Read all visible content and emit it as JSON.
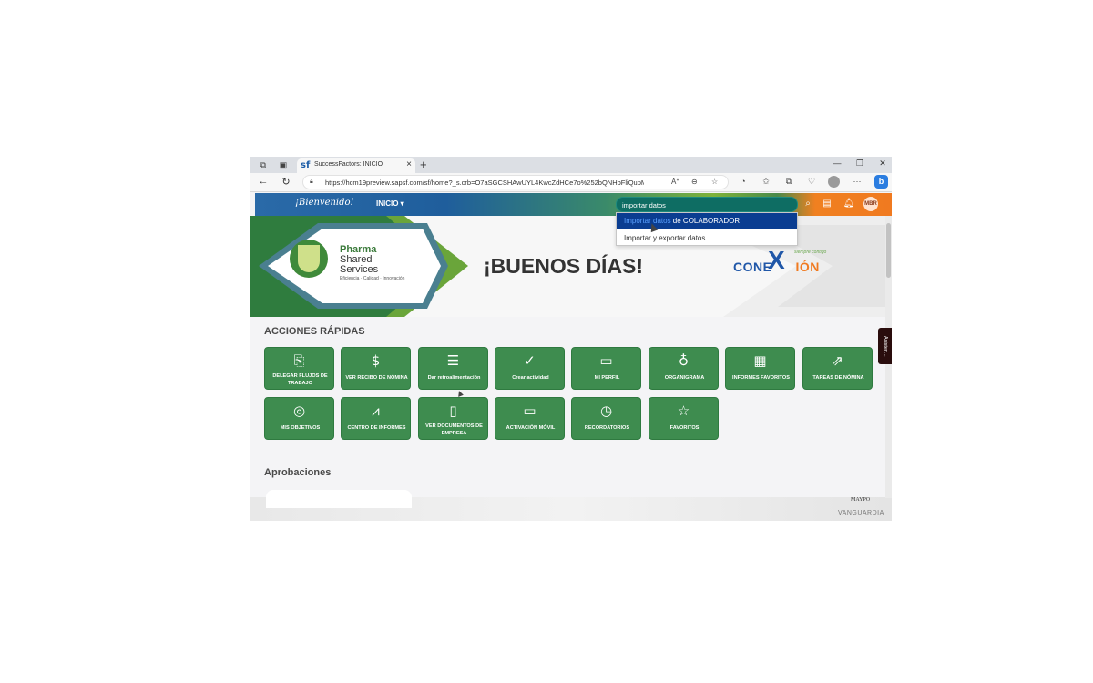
{
  "browser": {
    "tab_title": "SuccessFactors: INICIO",
    "tab_favicon": "sf",
    "url": "https://hcm19preview.sapsf.com/sf/home?_s.crb=O7aSGCSHAwUYL4KwcZdHCe7o%252bQNHbFliQupMkK...",
    "profile_badge": "b"
  },
  "header": {
    "welcome": "¡Bienvenido!",
    "nav_menu": "INICIO ▾",
    "search_query": "importar datos",
    "avatar_initials": "MBR"
  },
  "search_dropdown": {
    "items": [
      {
        "highlight": "Importar datos",
        "rest": " de COLABORADOR"
      },
      {
        "label": "Importar y exportar datos"
      }
    ]
  },
  "banner": {
    "brand_line1": "Pharma",
    "brand_line2": "Shared",
    "brand_line3": "Services",
    "brand_tagline": "Eficiencia · Calidad · Innovación",
    "greeting": "¡BUENOS DÍAS!",
    "conexion_prefix": "CONE",
    "conexion_x": "X",
    "conexion_suffix": "IÓN",
    "conexion_tag": "siempre contigo"
  },
  "quick_actions": {
    "title": "ACCIONES RÁPIDAS",
    "tiles": [
      {
        "label": "DELEGAR FLUJOS DE TRABAJO",
        "icon": "delegate-icon"
      },
      {
        "label": "VER RECIBO DE NÓMINA",
        "icon": "payslip-icon"
      },
      {
        "label": "Dar retroalimentación",
        "icon": "feedback-icon"
      },
      {
        "label": "Crear actividad",
        "icon": "clipboard-check-icon"
      },
      {
        "label": "MI PERFIL",
        "icon": "profile-card-icon"
      },
      {
        "label": "ORGANIGRAMA",
        "icon": "org-chart-icon"
      },
      {
        "label": "INFORMES FAVORITOS",
        "icon": "reports-icon"
      },
      {
        "label": "TAREAS DE NÓMINA",
        "icon": "payroll-tasks-icon"
      },
      {
        "label": "MIS OBJETIVOS",
        "icon": "target-icon"
      },
      {
        "label": "CENTRO DE INFORMES",
        "icon": "chart-icon"
      },
      {
        "label": "VER DOCUMENTOS DE EMPRESA",
        "icon": "document-icon"
      },
      {
        "label": "ACTIVACIÓN MÓVIL",
        "icon": "devices-icon"
      },
      {
        "label": "RECORDATORIOS",
        "icon": "reminder-icon"
      },
      {
        "label": "FAVORITOS",
        "icon": "favorites-icon"
      }
    ]
  },
  "approvals": {
    "title": "Aprobaciones"
  },
  "assistant_tab": "Asisten...",
  "watermark": {
    "line1": "MAYPO",
    "line2": "VANGUARDIA"
  }
}
